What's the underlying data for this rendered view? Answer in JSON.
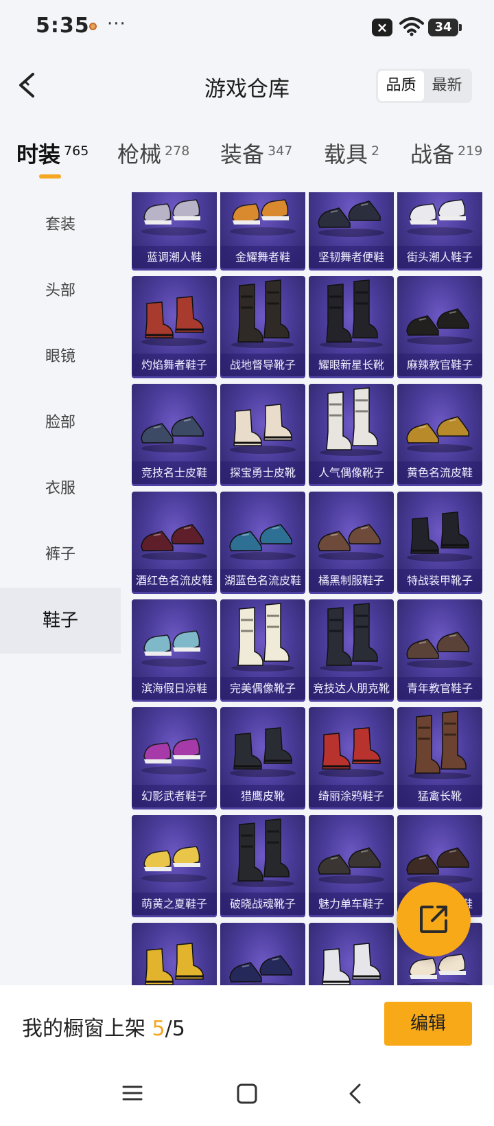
{
  "status_bar": {
    "time": "5:35",
    "more": "···",
    "battery": "34"
  },
  "header": {
    "title": "游戏仓库",
    "sort_options": [
      "品质",
      "最新"
    ],
    "active_sort": "品质"
  },
  "main_tabs": [
    {
      "label": "时装",
      "count": "765"
    },
    {
      "label": "枪械",
      "count": "278"
    },
    {
      "label": "装备",
      "count": "347"
    },
    {
      "label": "载具",
      "count": "2"
    },
    {
      "label": "战备",
      "count": "219"
    }
  ],
  "categories": [
    "套装",
    "头部",
    "眼镜",
    "脸部",
    "衣服",
    "裤子",
    "鞋子"
  ],
  "active_category": "鞋子",
  "items": [
    {
      "name": "蓝调潮人鞋",
      "shoe": "sneaker",
      "color": "#b9b3c8"
    },
    {
      "name": "金耀舞者鞋",
      "shoe": "sneaker",
      "color": "#d98a2e"
    },
    {
      "name": "坚韧舞者便鞋",
      "shoe": "shoe",
      "color": "#2b2f3d"
    },
    {
      "name": "街头潮人鞋子",
      "shoe": "sneaker",
      "color": "#e9e9ee"
    },
    {
      "name": "灼焰舞者鞋子",
      "shoe": "boot",
      "color": "#a83a2e"
    },
    {
      "name": "战地督导靴子",
      "shoe": "tallboot",
      "color": "#2f2a26"
    },
    {
      "name": "耀眼新星长靴",
      "shoe": "tallboot",
      "color": "#25232a"
    },
    {
      "name": "麻辣教官鞋子",
      "shoe": "shoe",
      "color": "#22201f"
    },
    {
      "name": "竞技名士皮鞋",
      "shoe": "shoe",
      "color": "#3d4a66"
    },
    {
      "name": "探宝勇士皮靴",
      "shoe": "boot",
      "color": "#e9dccb"
    },
    {
      "name": "人气偶像靴子",
      "shoe": "tallboot",
      "color": "#e8e4df"
    },
    {
      "name": "黄色名流皮鞋",
      "shoe": "shoe",
      "color": "#b98a2a"
    },
    {
      "name": "酒红色名流皮鞋",
      "shoe": "shoe",
      "color": "#5e1f2b"
    },
    {
      "name": "湖蓝色名流皮鞋",
      "shoe": "shoe",
      "color": "#2e6f94"
    },
    {
      "name": "橘黑制服鞋子",
      "shoe": "shoe",
      "color": "#6d4a3a"
    },
    {
      "name": "特战装甲靴子",
      "shoe": "boot",
      "color": "#22232a"
    },
    {
      "name": "滨海假日凉鞋",
      "shoe": "sneaker",
      "color": "#7fb8c8"
    },
    {
      "name": "完美偶像靴子",
      "shoe": "tallboot",
      "color": "#f0ead8"
    },
    {
      "name": "竞技达人朋克靴",
      "shoe": "tallboot",
      "color": "#2a2d36"
    },
    {
      "name": "青年教官鞋子",
      "shoe": "shoe",
      "color": "#5b4238"
    },
    {
      "name": "幻影武者鞋子",
      "shoe": "sneaker",
      "color": "#a63aa8"
    },
    {
      "name": "猎鹰皮靴",
      "shoe": "boot",
      "color": "#2a2c33"
    },
    {
      "name": "绮丽涂鸦鞋子",
      "shoe": "boot",
      "color": "#b8322e"
    },
    {
      "name": "猛禽长靴",
      "shoe": "tallboot",
      "color": "#6b4330"
    },
    {
      "name": "萌黄之夏鞋子",
      "shoe": "sneaker",
      "color": "#e9c64a"
    },
    {
      "name": "破晓战魂靴子",
      "shoe": "tallboot",
      "color": "#26282b"
    },
    {
      "name": "魅力单车鞋子",
      "shoe": "shoe",
      "color": "#3a3532"
    },
    {
      "name": "军旅教官皮鞋",
      "shoe": "shoe",
      "color": "#3e2b26"
    },
    {
      "name": "",
      "shoe": "boot",
      "color": "#e2b32c"
    },
    {
      "name": "",
      "shoe": "shoe",
      "color": "#25295a"
    },
    {
      "name": "",
      "shoe": "boot",
      "color": "#e6e6ea"
    },
    {
      "name": "",
      "shoe": "sneaker",
      "color": "#f1e4cf"
    }
  ],
  "bottom_bar": {
    "showcase_label": "我的橱窗上架",
    "showcase_current": "5",
    "showcase_sep": "/",
    "showcase_total": "5",
    "edit_label": "编辑"
  },
  "colors": {
    "accent": "#f8a918",
    "card": "#4a3c9a"
  }
}
